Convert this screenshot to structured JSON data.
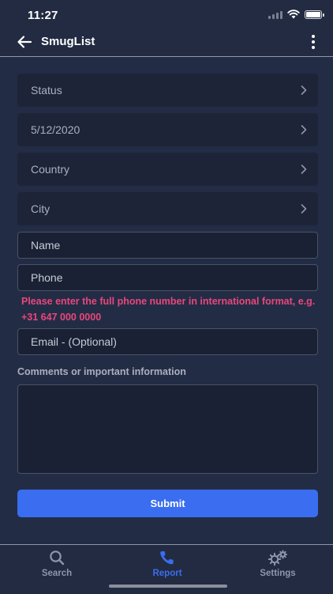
{
  "status_bar": {
    "time": "11:27"
  },
  "app_bar": {
    "title": "SmugList"
  },
  "form": {
    "status_label": "Status",
    "date_value": "5/12/2020",
    "country_label": "Country",
    "city_label": "City",
    "name_placeholder": "Name",
    "phone_placeholder": "Phone",
    "phone_error": "Please enter the full phone number in international format, e.g. +31 647 000 0000",
    "email_placeholder": "Email - (Optional)",
    "comments_label": "Comments or important information",
    "submit_label": "Submit"
  },
  "tabs": [
    {
      "label": "Search",
      "icon": "search-icon"
    },
    {
      "label": "Report",
      "icon": "phone-icon",
      "active": true
    },
    {
      "label": "Settings",
      "icon": "gears-icon"
    }
  ],
  "colors": {
    "background": "#222b42",
    "field": "#1d2438",
    "accent": "#3a6df0",
    "error": "#e8477b",
    "muted": "#8e96a8"
  }
}
